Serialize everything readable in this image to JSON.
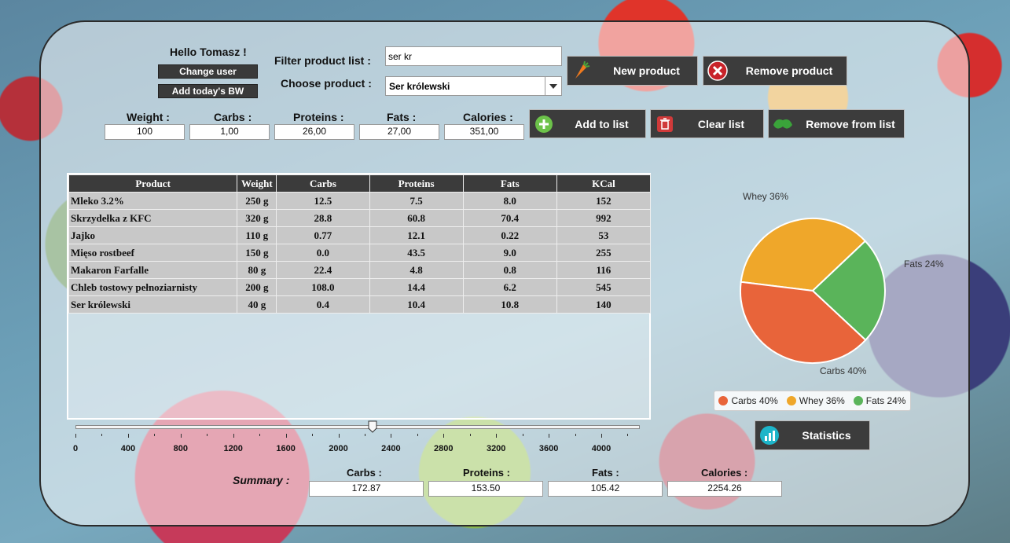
{
  "greeting": "Hello Tomasz !",
  "buttons": {
    "change_user": "Change user",
    "add_bw": "Add today's BW",
    "new_product": "New product",
    "remove_product": "Remove product",
    "add_to_list": "Add to list",
    "clear_list": "Clear list",
    "remove_from_list": "Remove from list",
    "statistics": "Statistics"
  },
  "filter": {
    "label": "Filter product list :",
    "value": "ser kr"
  },
  "choose": {
    "label": "Choose product :",
    "value": "Ser królewski"
  },
  "inputs": {
    "weight": {
      "label": "Weight :",
      "value": "100"
    },
    "carbs": {
      "label": "Carbs :",
      "value": "1,00"
    },
    "proteins": {
      "label": "Proteins :",
      "value": "26,00"
    },
    "fats": {
      "label": "Fats :",
      "value": "27,00"
    },
    "calories": {
      "label": "Calories :",
      "value": "351,00"
    }
  },
  "table": {
    "headers": [
      "Product",
      "Weight",
      "Carbs",
      "Proteins",
      "Fats",
      "KCal"
    ],
    "rows": [
      [
        "Mleko 3.2%",
        "250 g",
        "12.5",
        "7.5",
        "8.0",
        "152"
      ],
      [
        "Skrzydełka z KFC",
        "320 g",
        "28.8",
        "60.8",
        "70.4",
        "992"
      ],
      [
        "Jajko",
        "110 g",
        "0.77",
        "12.1",
        "0.22",
        "53"
      ],
      [
        "Mięso rostbeef",
        "150 g",
        "0.0",
        "43.5",
        "9.0",
        "255"
      ],
      [
        "Makaron Farfalle",
        "80 g",
        "22.4",
        "4.8",
        "0.8",
        "116"
      ],
      [
        "Chleb tostowy pełnoziarnisty",
        "200 g",
        "108.0",
        "14.4",
        "6.2",
        "545"
      ],
      [
        "Ser królewski",
        "40 g",
        "0.4",
        "10.4",
        "10.8",
        "140"
      ]
    ]
  },
  "slider": {
    "value": 2260,
    "max": 4300,
    "tick_labels": [
      "0",
      "400",
      "800",
      "1200",
      "1600",
      "2000",
      "2400",
      "2800",
      "3200",
      "3600",
      "4000"
    ]
  },
  "summary": {
    "label": "Summary :",
    "carbs": {
      "label": "Carbs :",
      "value": "172.87"
    },
    "proteins": {
      "label": "Proteins :",
      "value": "153.50"
    },
    "fats": {
      "label": "Fats :",
      "value": "105.42"
    },
    "calories": {
      "label": "Calories :",
      "value": "2254.26"
    }
  },
  "chart_data": {
    "type": "pie",
    "slices": [
      {
        "name": "Carbs",
        "value": 40,
        "label": "Carbs 40%",
        "color": "#e8643a"
      },
      {
        "name": "Whey",
        "value": 36,
        "label": "Whey 36%",
        "color": "#efa72a"
      },
      {
        "name": "Fats",
        "value": 24,
        "label": "Fats 24%",
        "color": "#5ab45a"
      }
    ],
    "legend": [
      "Carbs 40%",
      "Whey 36%",
      "Fats 24%"
    ],
    "legend_position": "bottom"
  }
}
